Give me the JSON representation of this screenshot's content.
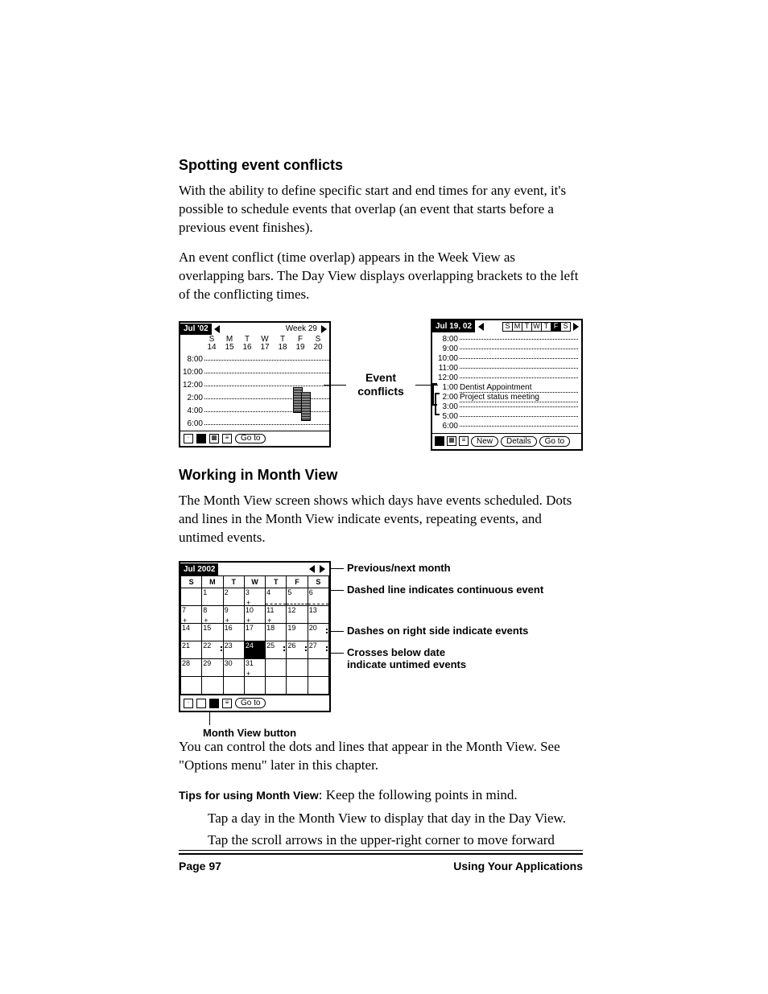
{
  "section1": {
    "heading": "Spotting event conflicts",
    "para1": "With the ability to define specific start and end times for any event, it's possible to schedule events that overlap (an event that starts before a previous event finishes).",
    "para2": "An event conflict (time overlap) appears in the Week View as overlapping bars. The Day View displays overlapping brackets to the left of the conflicting times."
  },
  "weekView": {
    "title": "Jul '02",
    "weekLabel": "Week 29",
    "days": [
      "S",
      "M",
      "T",
      "W",
      "T",
      "F",
      "S"
    ],
    "dates": [
      "14",
      "15",
      "16",
      "17",
      "18",
      "19",
      "20"
    ],
    "times": [
      "8:00",
      "10:00",
      "12:00",
      "2:00",
      "4:00",
      "6:00"
    ],
    "goTo": "Go to"
  },
  "midLabel": "Event conflicts",
  "dayView": {
    "title": "Jul 19, 02",
    "dow": [
      "S",
      "M",
      "T",
      "W",
      "T",
      "F",
      "S"
    ],
    "selectedIdx": 5,
    "lines": [
      {
        "t": "8:00",
        "txt": ""
      },
      {
        "t": "9:00",
        "txt": ""
      },
      {
        "t": "10:00",
        "txt": ""
      },
      {
        "t": "11:00",
        "txt": ""
      },
      {
        "t": "12:00",
        "txt": ""
      },
      {
        "t": "1:00",
        "txt": "Dentist Appointment"
      },
      {
        "t": "2:00",
        "txt": "Project status meeting"
      },
      {
        "t": "3:00",
        "txt": ""
      },
      {
        "t": "5:00",
        "txt": ""
      },
      {
        "t": "6:00",
        "txt": ""
      }
    ],
    "buttons": {
      "new": "New",
      "details": "Details",
      "goTo": "Go to"
    }
  },
  "section2": {
    "heading": "Working in Month View",
    "para1": "The Month View screen shows which days have events scheduled. Dots and lines in the Month View indicate events, repeating events, and untimed events."
  },
  "monthView": {
    "title": "Jul 2002",
    "dow": [
      "S",
      "M",
      "T",
      "W",
      "T",
      "F",
      "S"
    ],
    "weeks": [
      [
        "",
        "1",
        "2",
        "3",
        "4",
        "5",
        "6"
      ],
      [
        "7",
        "8",
        "9",
        "10",
        "11",
        "12",
        "13"
      ],
      [
        "14",
        "15",
        "16",
        "17",
        "18",
        "19",
        "20"
      ],
      [
        "21",
        "22",
        "23",
        "24",
        "25",
        "26",
        "27"
      ],
      [
        "28",
        "29",
        "30",
        "31",
        "",
        "",
        ""
      ]
    ],
    "goTo": "Go to"
  },
  "callouts": {
    "prevNext": "Previous/next month",
    "dashed": "Dashed line indicates continuous event",
    "dashes": "Dashes on right side indicate events",
    "crosses1": "Crosses below date",
    "crosses2": "indicate untimed events",
    "monthBtn": "Month View button"
  },
  "section3": {
    "para1": "You can control the dots and lines that appear in the Month View. See \"Options menu\" later in this chapter.",
    "tipsLabel": "Tips for using Month View",
    "tipsRest": ": Keep the following points in mind.",
    "tip1": "Tap a day in the Month View to display that day in the Day View.",
    "tip2": "Tap the scroll arrows in the upper-right corner to move forward"
  },
  "footer": {
    "left": "Page 97",
    "right": "Using Your Applications"
  }
}
